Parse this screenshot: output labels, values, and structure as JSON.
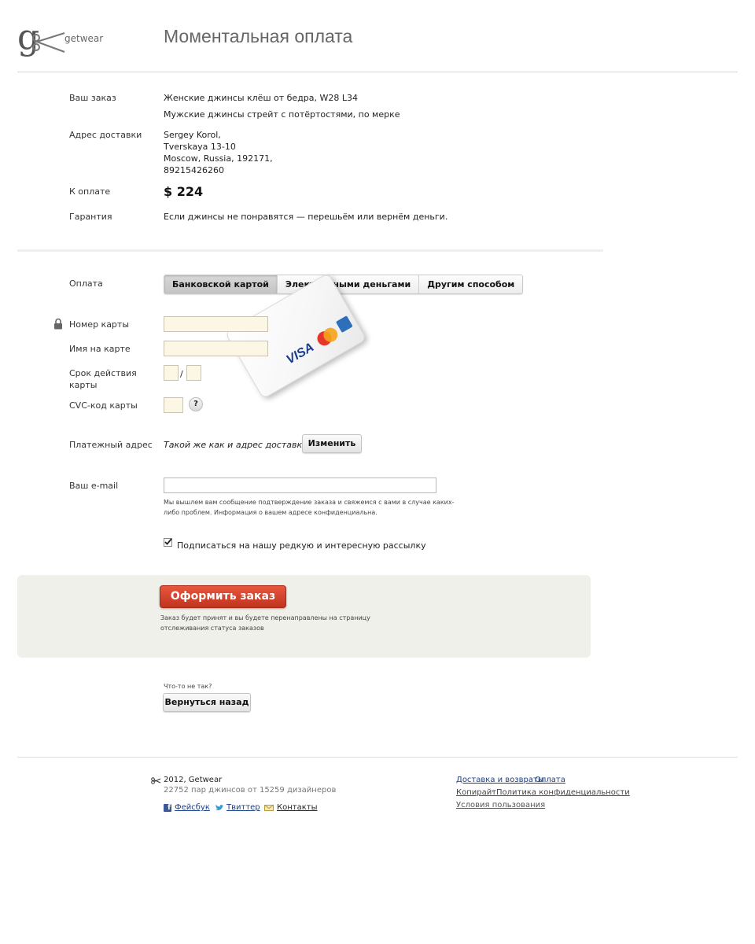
{
  "header": {
    "logo_letter": "g",
    "logo_text": "getwear",
    "page_title": "Моментальная оплата"
  },
  "summary": {
    "order_label": "Ваш заказ",
    "order_items": [
      "Женские джинсы клёш от бедра, W28 L34",
      "Мужские джинсы стрейт с потёртостями, по мерке"
    ],
    "address_label": "Адрес доставки",
    "address_lines": [
      "Sergey Korol,",
      "Tverskaya 13-10",
      "Moscow, Russia, 192171,",
      "89215426260"
    ],
    "total_label": "К оплате",
    "total_value": "$ 224",
    "guarantee_label": "Гарантия",
    "guarantee_text": "Если джинсы не понравятся — перешьём или вернём деньги."
  },
  "payment": {
    "label": "Оплата",
    "tabs": [
      "Банковской картой",
      "Электронными деньгами",
      "Другим способом"
    ],
    "active_tab": 0,
    "card_number_label": "Номер карты",
    "card_name_label": "Имя на карте",
    "expiry_label_1": "Срок действия",
    "expiry_label_2": "карты",
    "expiry_separator": "/",
    "cvc_label": "CVC-код карты",
    "cvc_help": "?",
    "card_brands": [
      "VISA",
      "MasterCard",
      "American Express"
    ],
    "billing_label": "Платежный адрес",
    "billing_value": "Такой же как и адрес доставки",
    "billing_change": "Изменить",
    "email_label": "Ваш e-mail",
    "email_value": "",
    "email_note_1": "Мы вышлем вам сообщение подтверждение заказа и свяжемся с вами в случае каких-",
    "email_note_2": "либо проблем. Информация о вашем адресе конфиденциальна.",
    "subscribe_checked": true,
    "subscribe_label": "Подписаться на нашу редкую и интересную рассылку"
  },
  "order": {
    "button": "Оформить заказ",
    "note_1": "Заказ будет принят и вы будете перенаправлены на страницу",
    "note_2": "отслеживания статуса заказов"
  },
  "back": {
    "question": "Что-то не так?",
    "button": "Вернуться назад"
  },
  "footer": {
    "copyright": "2012, Getwear",
    "stats": "22752 пар джинсов от 15259 дизайнеров",
    "facebook": "Фейсбук",
    "twitter": "Твиттер",
    "contacts": "Контакты",
    "links_row1": [
      "Доставка и возвраты",
      "Оплата"
    ],
    "links_row2": [
      "Копирайт",
      "Политика конфиденциальности"
    ],
    "links_row3": [
      "Условия пользования"
    ],
    "separator": "·"
  },
  "colors": {
    "accent_red": "#d24a31",
    "field_bg": "#fcf7e4",
    "panel_bg": "#f0f0ea",
    "link_blue": "#1a3f8a"
  }
}
